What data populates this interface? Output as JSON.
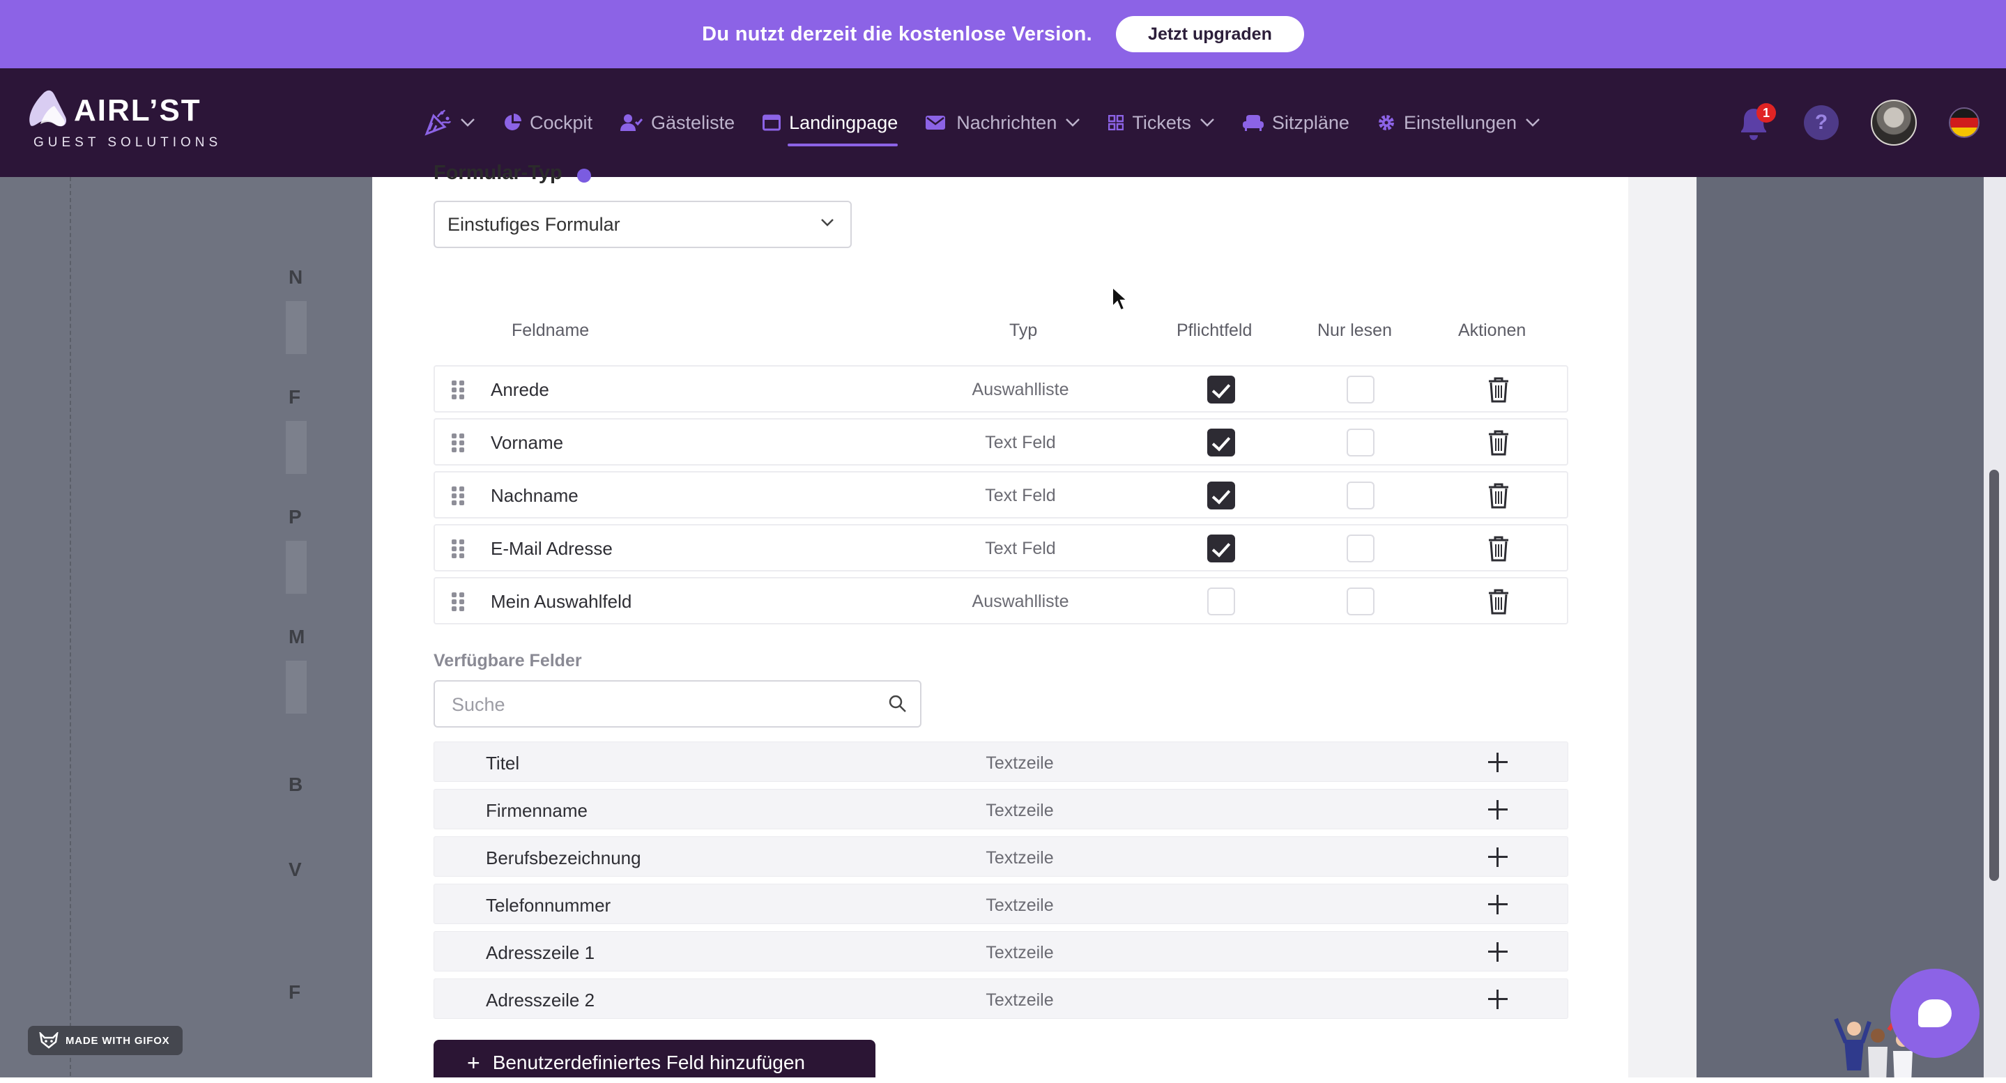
{
  "promo": {
    "text": "Du nutzt derzeit die kostenlose Version.",
    "button": "Jetzt upgraden"
  },
  "logo": {
    "word": "AIRL’ST",
    "sub": "GUEST SOLUTIONS"
  },
  "nav": {
    "items": [
      {
        "label": "",
        "icon": "party-popper-icon",
        "dropdown": true
      },
      {
        "label": "Cockpit",
        "icon": "pie-chart-icon",
        "dropdown": false
      },
      {
        "label": "Gästeliste",
        "icon": "user-check-icon",
        "dropdown": false
      },
      {
        "label": "Landingpage",
        "icon": "window-icon",
        "dropdown": false,
        "active": true
      },
      {
        "label": "Nachrichten",
        "icon": "envelope-icon",
        "dropdown": true
      },
      {
        "label": "Tickets",
        "icon": "grid-icon",
        "dropdown": true
      },
      {
        "label": "Sitzpläne",
        "icon": "armchair-icon",
        "dropdown": false
      },
      {
        "label": "Einstellungen",
        "icon": "gear-icon",
        "dropdown": true
      }
    ],
    "notification_count": "1",
    "help": "?"
  },
  "form": {
    "type_label": "Formular-Typ",
    "type_value": "Einstufiges Formular"
  },
  "table": {
    "headers": {
      "name": "Feldname",
      "type": "Typ",
      "required": "Pflichtfeld",
      "readonly": "Nur lesen",
      "actions": "Aktionen"
    },
    "rows": [
      {
        "name": "Anrede",
        "type": "Auswahlliste",
        "required": true,
        "readonly": false
      },
      {
        "name": "Vorname",
        "type": "Text Feld",
        "required": true,
        "readonly": false
      },
      {
        "name": "Nachname",
        "type": "Text Feld",
        "required": true,
        "readonly": false
      },
      {
        "name": "E-Mail Adresse",
        "type": "Text Feld",
        "required": true,
        "readonly": false
      },
      {
        "name": "Mein Auswahlfeld",
        "type": "Auswahlliste",
        "required": false,
        "readonly": false
      }
    ]
  },
  "available": {
    "label": "Verfügbare Felder",
    "search_placeholder": "Suche",
    "rows": [
      {
        "name": "Titel",
        "type": "Textzeile"
      },
      {
        "name": "Firmenname",
        "type": "Textzeile"
      },
      {
        "name": "Berufsbezeichnung",
        "type": "Textzeile"
      },
      {
        "name": "Telefonnummer",
        "type": "Textzeile"
      },
      {
        "name": "Adresszeile 1",
        "type": "Textzeile"
      },
      {
        "name": "Adresszeile 2",
        "type": "Textzeile"
      }
    ]
  },
  "add_button": "Benutzerdefiniertes Feld hinzufügen",
  "gifox": "MADE WITH GIFOX",
  "colors": {
    "accent": "#8c63e6",
    "nav_bg": "#2c1538",
    "checkbox_on": "#2d2b33"
  }
}
